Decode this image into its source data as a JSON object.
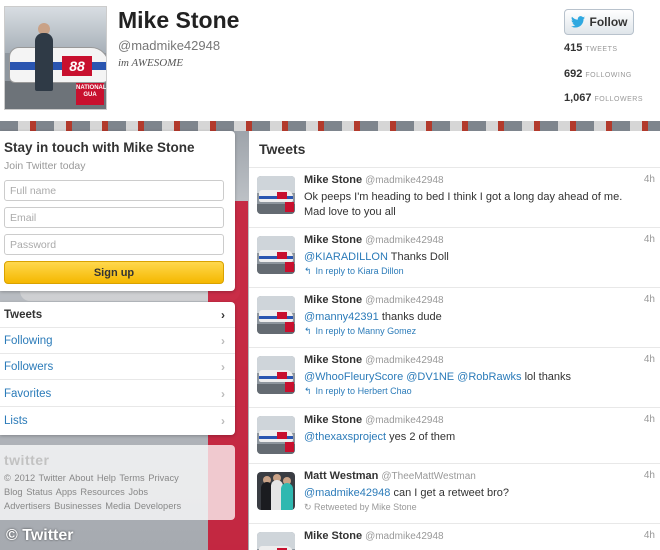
{
  "profile": {
    "name": "Mike Stone",
    "handle": "@madmike42948",
    "bio": "im AWESOME",
    "avatar_sign": "NATIONAL GUA",
    "avatar_car_number": "88",
    "follow_label": "Follow",
    "stats": [
      {
        "value": "415",
        "label": "TWEETS"
      },
      {
        "value": "692",
        "label": "FOLLOWING"
      },
      {
        "value": "1,067",
        "label": "FOLLOWERS"
      }
    ]
  },
  "signup": {
    "title": "Stay in touch with Mike Stone",
    "subtitle": "Join Twitter today",
    "full_name_placeholder": "Full name",
    "email_placeholder": "Email",
    "password_placeholder": "Password",
    "button": "Sign up"
  },
  "nav": {
    "items": [
      {
        "label": "Tweets",
        "active": true
      },
      {
        "label": "Following"
      },
      {
        "label": "Followers"
      },
      {
        "label": "Favorites"
      },
      {
        "label": "Lists"
      }
    ],
    "chevron": "›"
  },
  "footer": {
    "wordmark": "twitter",
    "line1": "© 2012 Twitter  About  Help  Terms  Privacy",
    "line2": "Blog  Status  Apps  Resources  Jobs",
    "line3": "Advertisers  Businesses  Media  Developers"
  },
  "watermark": "© Twitter",
  "tweets": {
    "heading": "Tweets",
    "items": [
      {
        "name": "Mike Stone",
        "handle": "@madmike42948",
        "time": "4h",
        "mention": "",
        "text": "Ok peeps I'm heading to bed I think I got a long day ahead of me. Mad love to you all",
        "reply": ""
      },
      {
        "name": "Mike Stone",
        "handle": "@madmike42948",
        "time": "4h",
        "mention": "@KIARADILLON",
        "text": " Thanks Doll",
        "reply": "In reply to Kiara Dillon"
      },
      {
        "name": "Mike Stone",
        "handle": "@madmike42948",
        "time": "4h",
        "mention": "@manny42391",
        "text": " thanks dude",
        "reply": "In reply to Manny Gomez"
      },
      {
        "name": "Mike Stone",
        "handle": "@madmike42948",
        "time": "4h",
        "mention": "@WhooFleuryScore @DV1NE @RobRawks",
        "text": " lol thanks",
        "reply": "In reply to Herbert Chao"
      },
      {
        "name": "Mike Stone",
        "handle": "@madmike42948",
        "time": "4h",
        "mention": "@thexaxsproject",
        "text": " yes 2 of them",
        "reply": ""
      },
      {
        "name": "Matt Westman",
        "handle": "@TheeMattWestman",
        "time": "4h",
        "mention": "@madmike42948",
        "text": " can I get a retweet bro?",
        "retweet": "Retweeted by Mike Stone"
      },
      {
        "name": "Mike Stone",
        "handle": "@madmike42948",
        "time": "4h",
        "mention": "",
        "text": "",
        "reply": ""
      }
    ]
  }
}
